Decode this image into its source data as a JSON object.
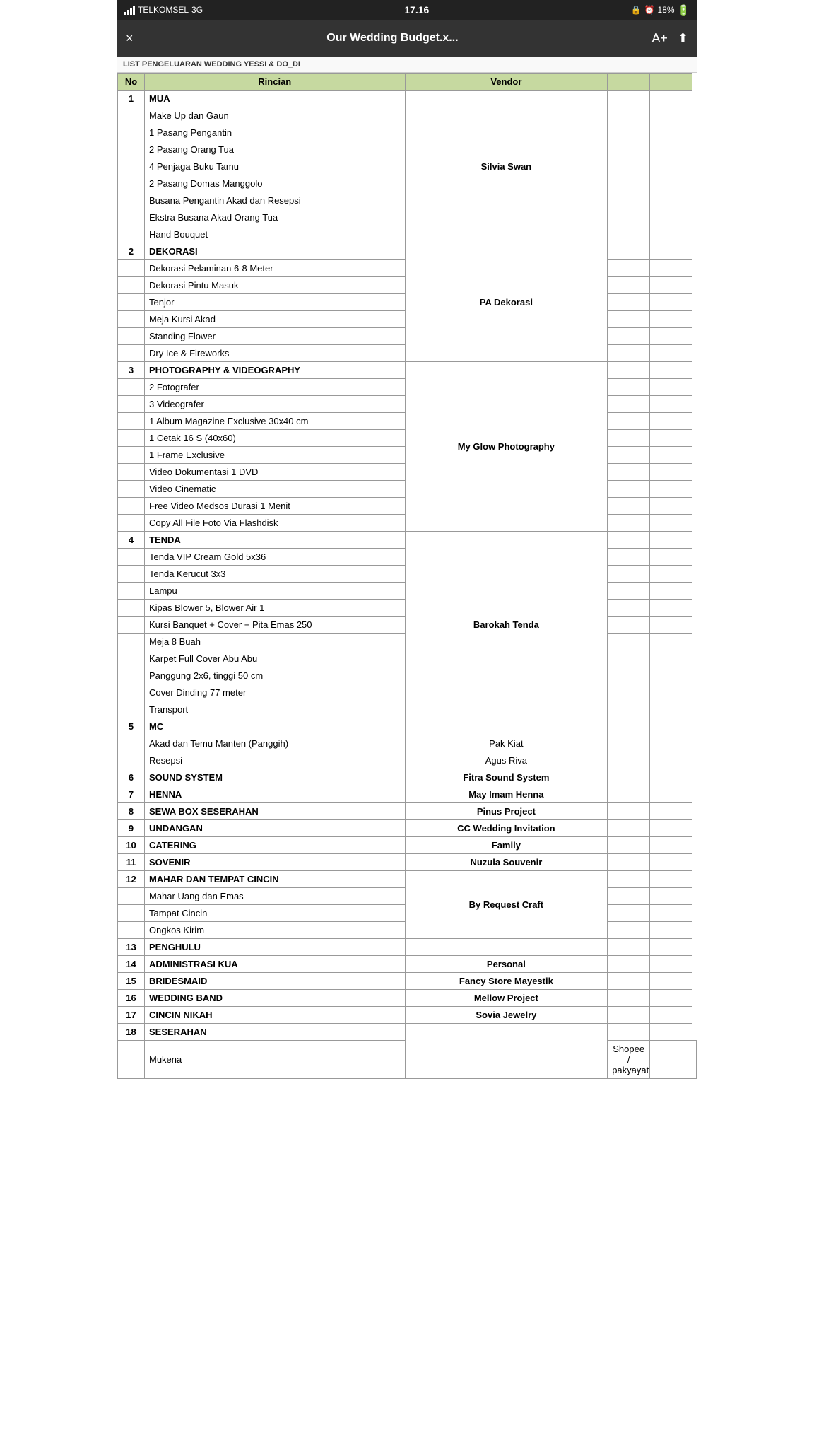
{
  "statusBar": {
    "carrier": "TELKOMSEL",
    "network": "3G",
    "time": "17.16",
    "battery": "18%"
  },
  "topBar": {
    "title": "Our Wedding Budget.x...",
    "closeLabel": "×",
    "fontIcon": "A+",
    "shareIcon": "⬆"
  },
  "subtitle": "LIST PENGELUARAN WEDDING YESSI & DO_DI",
  "tableHeaders": {
    "no": "No",
    "rincian": "Rincian",
    "vendor": "Vendor"
  },
  "sections": [
    {
      "no": "1",
      "category": "MUA",
      "vendor": "Silvia Swan",
      "items": [
        "Make Up dan Gaun",
        "1 Pasang Pengantin",
        "2 Pasang Orang Tua",
        "4 Penjaga Buku Tamu",
        "2 Pasang Domas Manggolo",
        "Busana Pengantin Akad dan Resepsi",
        "Ekstra Busana Akad Orang Tua",
        "Hand Bouquet"
      ]
    },
    {
      "no": "2",
      "category": "DEKORASI",
      "vendor": "PA Dekorasi",
      "items": [
        "Dekorasi Pelaminan 6-8 Meter",
        "Dekorasi Pintu Masuk",
        "Tenjor",
        "Meja Kursi Akad",
        "Standing Flower",
        "Dry Ice & Fireworks"
      ]
    },
    {
      "no": "3",
      "category": "PHOTOGRAPHY & VIDEOGRAPHY",
      "vendor": "My Glow Photography",
      "items": [
        "2 Fotografer",
        "3 Videografer",
        "1 Album Magazine Exclusive 30x40 cm",
        "1 Cetak 16 S (40x60)",
        "1 Frame Exclusive",
        "Video Dokumentasi 1 DVD",
        "Video Cinematic",
        "Free Video Medsos Durasi 1 Menit",
        "Copy All File Foto Via Flashdisk"
      ]
    },
    {
      "no": "4",
      "category": "TENDA",
      "vendor": "Barokah Tenda",
      "items": [
        "Tenda VIP Cream Gold 5x36",
        "Tenda Kerucut 3x3",
        "Lampu",
        "Kipas Blower 5, Blower Air 1",
        "Kursi Banquet + Cover + Pita Emas 250",
        "Meja 8 Buah",
        "Karpet Full Cover Abu Abu",
        "Panggung 2x6, tinggi 50 cm",
        "Cover Dinding 77 meter",
        "Transport"
      ]
    },
    {
      "no": "5",
      "category": "MC",
      "vendor": null,
      "items": [],
      "subRows": [
        {
          "label": "Akad dan Temu Manten (Panggih)",
          "vendor": "Pak Kiat"
        },
        {
          "label": "Resepsi",
          "vendor": "Agus Riva"
        }
      ]
    },
    {
      "no": "6",
      "category": "SOUND SYSTEM",
      "vendor": "Fitra Sound System",
      "items": []
    },
    {
      "no": "7",
      "category": "HENNA",
      "vendor": "May Imam Henna",
      "items": []
    },
    {
      "no": "8",
      "category": "SEWA BOX SESERAHAN",
      "vendor": "Pinus Project",
      "items": []
    },
    {
      "no": "9",
      "category": "UNDANGAN",
      "vendor": "CC Wedding Invitation",
      "items": []
    },
    {
      "no": "10",
      "category": "CATERING",
      "vendor": "Family",
      "items": []
    },
    {
      "no": "11",
      "category": "SOVENIR",
      "vendor": "Nuzula Souvenir",
      "items": []
    },
    {
      "no": "12",
      "category": "MAHAR DAN TEMPAT CINCIN",
      "vendor": "By Request Craft",
      "items": [
        "Mahar Uang dan Emas",
        "Tampat Cincin",
        "Ongkos Kirim"
      ]
    },
    {
      "no": "13",
      "category": "PENGHULU",
      "vendor": "",
      "items": []
    },
    {
      "no": "14",
      "category": "ADMINISTRASI KUA",
      "vendor": "Personal",
      "items": []
    },
    {
      "no": "15",
      "category": "BRIDESMAID",
      "vendor": "Fancy Store Mayestik",
      "items": []
    },
    {
      "no": "16",
      "category": "WEDDING BAND",
      "vendor": "Mellow Project",
      "items": []
    },
    {
      "no": "17",
      "category": "CINCIN NIKAH",
      "vendor": "Sovia Jewelry",
      "items": []
    },
    {
      "no": "18",
      "category": "SESERAHAN",
      "vendor": "",
      "items": [
        "Mukena"
      ],
      "lastVendor": "Shopee / pakyayat"
    }
  ]
}
